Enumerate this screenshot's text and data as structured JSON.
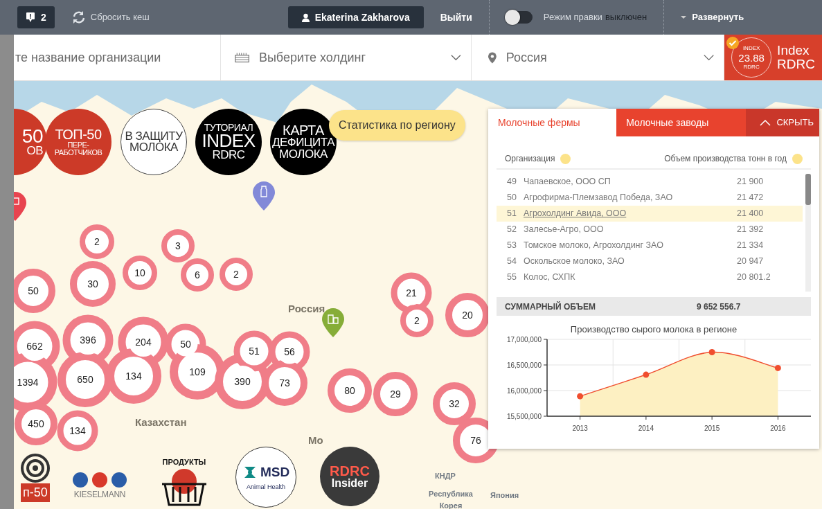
{
  "toolbar": {
    "notifications": "2",
    "reset_cache": "Сбросить кеш",
    "user": "Ekaterina Zakharova",
    "logout": "Выйти",
    "edit_mode": {
      "label": "Режим правки",
      "state": "выключен",
      "on": false
    },
    "expand": "Развернуть"
  },
  "filters": {
    "organization": {
      "value": "те название организации"
    },
    "holding": {
      "placeholder": "Выберите холдинг"
    },
    "region": {
      "value": "Россия"
    },
    "index": {
      "caption_top": "INDEX",
      "score": "23.88",
      "caption_bottom": "RDRC",
      "title_line1": "Index",
      "title_line2": "RDRC",
      "checked": true
    }
  },
  "map": {
    "feature_circles": [
      {
        "kind": "red",
        "lines": [
          "50",
          "ОВ"
        ]
      },
      {
        "kind": "red",
        "lines": [
          "ТОП-50",
          "ПЕРЕ-",
          "РАБОТЧИКОВ"
        ]
      },
      {
        "kind": "white",
        "lines": [
          "В ЗАЩИТУ",
          "МОЛОКА"
        ]
      },
      {
        "kind": "black",
        "lines": [
          "ТУТОРИАЛ",
          "INDEX",
          "RDRC"
        ]
      },
      {
        "kind": "black",
        "lines": [
          "КАРТА",
          "ДЕФИЦИТА",
          "МОЛОКА"
        ]
      }
    ],
    "stats_button": "Статистика по региону",
    "labels": [
      "Россия",
      "Казахстан",
      "Мо",
      "КНДР",
      "Республика Корея",
      "Япония"
    ],
    "clusters": [
      "2",
      "3",
      "10",
      "6",
      "2",
      "50",
      "30",
      "21",
      "2",
      "20",
      "662",
      "396",
      "204",
      "50",
      "51",
      "56",
      "1394",
      "650",
      "134",
      "109",
      "390",
      "73",
      "80",
      "29",
      "32",
      "76",
      "450",
      "134"
    ],
    "pins": [
      {
        "kind": "shop"
      },
      {
        "kind": "bottle"
      },
      {
        "kind": "farm"
      }
    ],
    "sponsors": [
      {
        "kind": "target",
        "lines": [
          "п-50"
        ]
      },
      {
        "kind": "kieselmann",
        "lines": [
          "KIESELMANN"
        ]
      },
      {
        "kind": "basket",
        "lines": [
          "ПРОДУКТЫ"
        ]
      },
      {
        "kind": "msd",
        "lines": [
          "MSD",
          "Animal Health"
        ]
      },
      {
        "kind": "insider",
        "lines": [
          "RDRC",
          "Insider"
        ]
      }
    ]
  },
  "panel": {
    "tabs": [
      {
        "label": "Молочные фермы",
        "selected": true
      },
      {
        "label": "Молочные заводы",
        "selected": false
      }
    ],
    "hide": "СКРЫТЬ",
    "columns": [
      "Организация",
      "Объем производства тонн в год"
    ],
    "rows": [
      {
        "rank": "49",
        "name": "Чапаевское, ООО СП",
        "volume": "21 900",
        "selected": false
      },
      {
        "rank": "50",
        "name": "Агрофирма-Племзавод Победа, ЗАО",
        "volume": "21 472",
        "selected": false
      },
      {
        "rank": "51",
        "name": "Агрохолдинг Авида, ООО",
        "volume": "21 400",
        "selected": true
      },
      {
        "rank": "52",
        "name": "Залесье-Агро, ООО",
        "volume": "21 392",
        "selected": false
      },
      {
        "rank": "53",
        "name": "Томское молоко, Агрохолдинг ЗАО",
        "volume": "21 334",
        "selected": false
      },
      {
        "rank": "54",
        "name": "Оскольское молоко, ЗАО",
        "volume": "20 947",
        "selected": false
      },
      {
        "rank": "55",
        "name": "Колос, СХПК",
        "volume": "20 801.2",
        "selected": false
      }
    ],
    "total_label": "СУММАРНЫЙ ОБЪЕМ",
    "total": "9 652 556.7",
    "chart_data": {
      "type": "area",
      "title": "Производство сырого молока в регионе",
      "x": [
        2013,
        2014,
        2015,
        2016
      ],
      "series": [
        {
          "color": "#f04e2f",
          "values": [
            15890000,
            16310000,
            16750000,
            16440000
          ]
        }
      ],
      "xlim": [
        2012.5,
        2016.5
      ],
      "ylim": [
        15500000,
        17000000
      ],
      "xticks": [
        2013,
        2014,
        2015,
        2016
      ],
      "yticks": [
        {
          "value": 15500000,
          "label": "15,500,000"
        },
        {
          "value": 16000000,
          "label": "16,000,000"
        },
        {
          "value": 16500000,
          "label": "16,500,000"
        },
        {
          "value": 17000000,
          "label": "17,000,000"
        }
      ]
    }
  }
}
